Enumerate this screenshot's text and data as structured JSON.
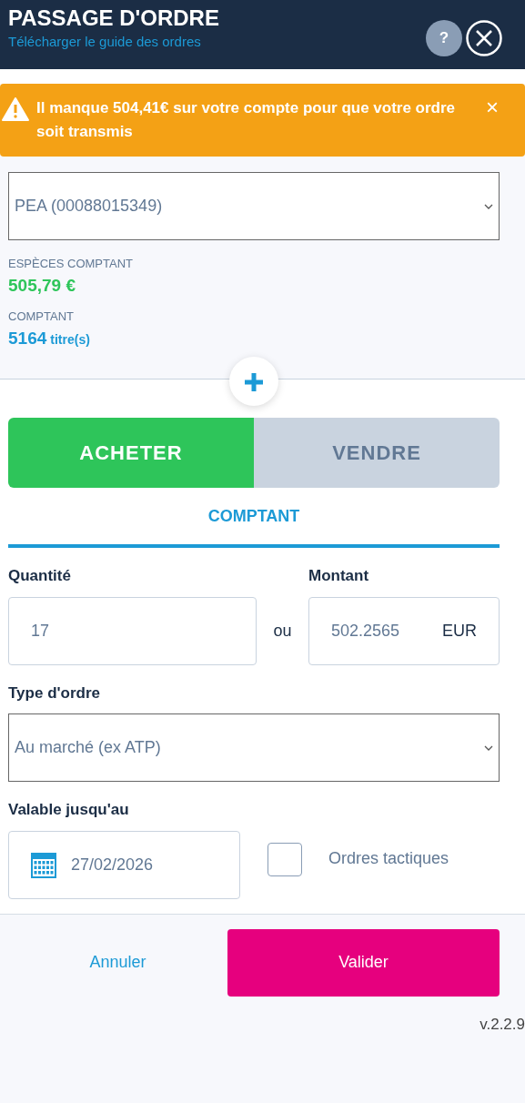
{
  "header": {
    "title": "PASSAGE D'ORDRE",
    "guide_link": "Télécharger le guide des ordres",
    "help": "?"
  },
  "alert": {
    "text": "Il manque 504,41€ sur votre compte pour que votre ordre soit transmis",
    "dismiss": "×"
  },
  "account": {
    "value": "PEA (00088015349)"
  },
  "balances": [
    {
      "kind": "cash",
      "label": "ESPÈCES COMPTANT",
      "value": "505,79 €"
    },
    {
      "kind": "shares",
      "label": "COMPTANT",
      "value": "5164",
      "unit": "titre(s)"
    }
  ],
  "side_tabs": [
    {
      "label": "ACHETER",
      "selected": true
    },
    {
      "label": "VENDRE",
      "selected": false
    }
  ],
  "mode_tabs": [
    {
      "label": "COMPTANT",
      "selected": true
    }
  ],
  "quantity": {
    "label": "Quantité",
    "value": "17"
  },
  "separator": "ou",
  "amount": {
    "label": "Montant",
    "value": "502.2565",
    "currency": "EUR"
  },
  "order_type": {
    "label": "Type d'ordre",
    "value": "Au marché (ex ATP)"
  },
  "validity": {
    "label": "Valable jusqu'au",
    "value": "27/02/2026"
  },
  "tactical": {
    "label": "Ordres tactiques",
    "checked": false
  },
  "buttons": {
    "cancel": "Annuler",
    "submit": "Valider"
  },
  "version": "v.2.2.9"
}
